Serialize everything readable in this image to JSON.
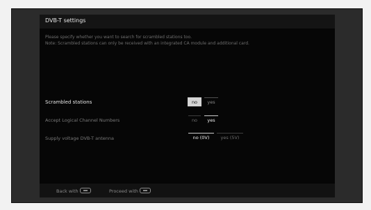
{
  "title": "DVB-T settings",
  "description": {
    "line1": "Please specify whether you want to search for scrambled stations too.",
    "line2": "Note: Scrambled stations can only be received with an integrated CA module and additional card."
  },
  "settings": [
    {
      "label": "Scrambled stations",
      "options": [
        "no",
        "yes"
      ],
      "selected": "no"
    },
    {
      "label": "Accept Logical Channel Numbers",
      "options": [
        "no",
        "yes"
      ],
      "selected": "yes"
    },
    {
      "label": "Supply voltage DVB-T antenna",
      "options": [
        "no (0V)",
        "yes (5V)"
      ],
      "selected": "no (0V)"
    }
  ],
  "footer": {
    "back_label": "Back with",
    "back_icon": "back-key-icon",
    "proceed_label": "Proceed with",
    "proceed_icon": "ok-key-icon"
  }
}
